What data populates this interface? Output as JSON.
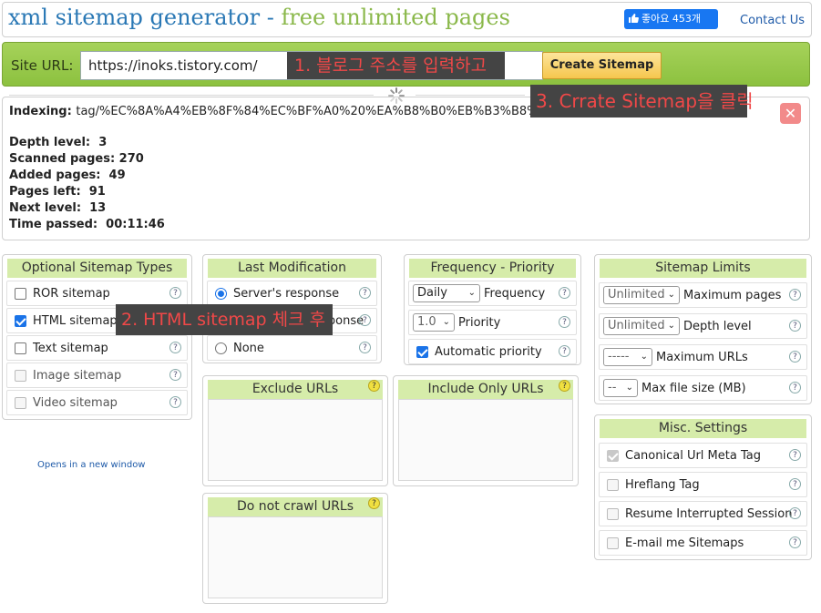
{
  "header": {
    "title_part1": "xml sitemap generator - ",
    "title_part2": "free unlimited pages",
    "like_label": "좋아요 453개",
    "contact_label": "Contact Us"
  },
  "urlbar": {
    "site_label": "Site URL:",
    "url_value": "https://inoks.tistory.com/",
    "create_label": "Create Sitemap"
  },
  "annotations": {
    "step1": "1. 블로그 주소를 입력하고",
    "step2": "2. HTML sitemap 체크 후",
    "step3": "3. Crrate Sitemap을 클릭"
  },
  "progress": {
    "indexing_label": "Indexing:",
    "indexing_value": "tag/%EC%8A%A4%EB%8F%84%EC%BF%A0%20%EA%B8%B0%EB%B3%B8%2",
    "depth_label": "Depth level:",
    "depth_value": "3",
    "scanned_label": "Scanned pages:",
    "scanned_value": "270",
    "added_label": "Added pages:",
    "added_value": "49",
    "left_label": "Pages left:",
    "left_value": "91",
    "next_label": "Next level:",
    "next_value": "13",
    "time_label": "Time passed:",
    "time_value": "00:11:46"
  },
  "sitemap_types": {
    "title": "Optional Sitemap Types",
    "items": [
      {
        "label": "ROR sitemap",
        "checked": false
      },
      {
        "label": "HTML sitemap",
        "checked": true
      },
      {
        "label": "Text sitemap",
        "checked": false
      },
      {
        "label": "Image sitemap",
        "checked": false
      },
      {
        "label": "Video sitemap",
        "checked": false
      }
    ],
    "opens_new": "Opens in a new window"
  },
  "last_mod": {
    "title": "Last Modification",
    "options": [
      "Server's response",
      "Use server's response",
      "None"
    ]
  },
  "freq": {
    "title": "Frequency - Priority",
    "frequency_value": "Daily",
    "frequency_label": "Frequency",
    "priority_value": "1.0",
    "priority_label": "Priority",
    "auto_label": "Automatic priority"
  },
  "limits": {
    "title": "Sitemap Limits",
    "max_pages_value": "Unlimited",
    "max_pages_label": "Maximum pages",
    "depth_value": "Unlimited",
    "depth_label": "Depth level",
    "max_urls_value": "-----",
    "max_urls_label": "Maximum URLs",
    "file_size_value": "--",
    "file_size_label": "Max file size (MB)"
  },
  "misc": {
    "title": "Misc. Settings",
    "items": [
      "Canonical Url Meta Tag",
      "Hreflang Tag",
      "Resume Interrupted Session",
      "E-mail me Sitemaps"
    ]
  },
  "exclude": {
    "title": "Exclude URLs"
  },
  "include": {
    "title": "Include Only URLs"
  },
  "nocrawl": {
    "title": "Do not crawl URLs"
  },
  "help_glyph": "?",
  "close_glyph": "✕"
}
